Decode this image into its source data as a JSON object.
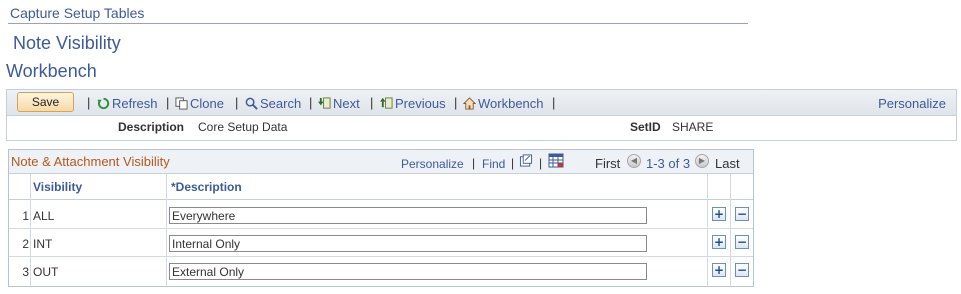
{
  "breadcrumb": "Capture Setup Tables",
  "page_title": "Note Visibility",
  "section_title": "Workbench",
  "toolbar": {
    "save_label": "Save",
    "refresh_label": "Refresh",
    "clone_label": "Clone",
    "search_label": "Search",
    "next_label": "Next",
    "previous_label": "Previous",
    "workbench_label": "Workbench",
    "personalize_label": "Personalize",
    "separator": "|"
  },
  "info": {
    "description_label": "Description",
    "description_value": "Core Setup Data",
    "setid_label": "SetID",
    "setid_value": "SHARE"
  },
  "grid": {
    "title": "Note & Attachment Visibility",
    "personalize_label": "Personalize",
    "find_label": "Find",
    "first_label": "First",
    "range_label": "1-3 of 3",
    "last_label": "Last",
    "columns": [
      "Visibility",
      "*Description"
    ],
    "rows": [
      {
        "num": "1",
        "visibility": "ALL",
        "description": "Everywhere"
      },
      {
        "num": "2",
        "visibility": "INT",
        "description": "Internal Only"
      },
      {
        "num": "3",
        "visibility": "OUT",
        "description": "External Only"
      }
    ],
    "add_symbol": "+",
    "delete_symbol": "−"
  },
  "colors": {
    "link": "#3d5a99",
    "grid_title": "#b15a1e",
    "save_button": "#f7d9a6"
  }
}
